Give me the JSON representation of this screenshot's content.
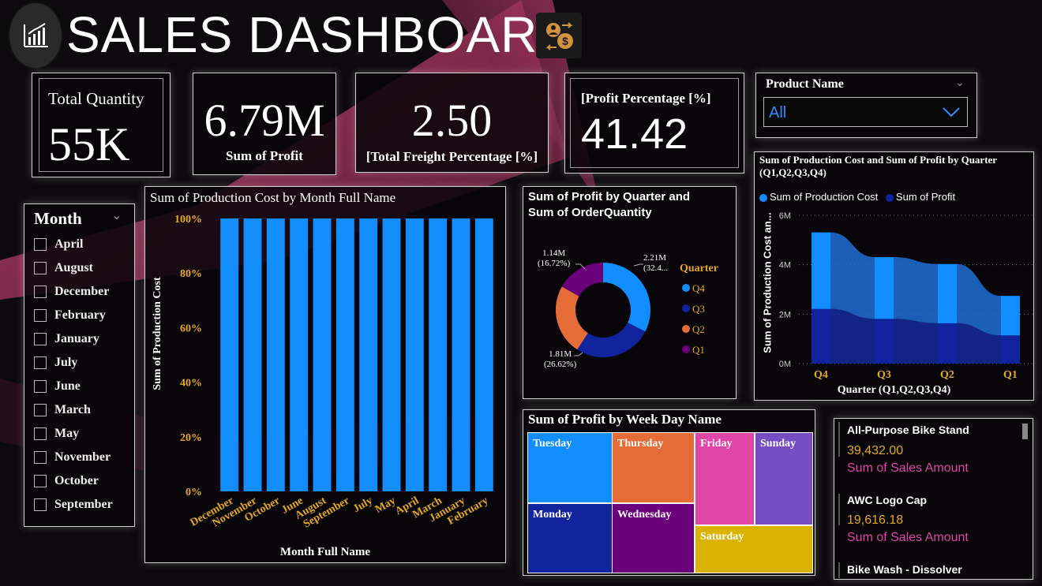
{
  "header": {
    "title": "SALES DASHBOARD"
  },
  "kpis": {
    "total_quantity_label": "Total Quantity",
    "total_quantity_value": "55K",
    "profit_value": "6.79M",
    "profit_label": "Sum of Profit",
    "freight_value": "2.50",
    "freight_label": "[Total Freight Percentage [%]",
    "profit_pct_label": "[Profit Percentage [%]",
    "profit_pct_value": "41.42"
  },
  "product_slicer": {
    "label": "Product Name",
    "value": "All"
  },
  "month_slicer": {
    "label": "Month",
    "items": [
      "April",
      "August",
      "December",
      "February",
      "January",
      "July",
      "June",
      "March",
      "May",
      "November",
      "October",
      "September"
    ]
  },
  "bar_chart": {
    "title": "Sum of Production Cost by Month Full Name",
    "xlabel": "Month Full Name",
    "ylabel": "Sum of Production Cost",
    "ticks": [
      "100%",
      "80%",
      "60%",
      "40%",
      "20%",
      "0%"
    ]
  },
  "donut_chart": {
    "title_line1": "Sum of Profit by Quarter and",
    "title_line2": "Sum of OrderQuantity",
    "legend_title": "Quarter",
    "labels": {
      "q4_value": "2.21M",
      "q4_pct": "(32.4...",
      "q3_value": "1.81M",
      "q3_pct": "(26.62%)",
      "q1_value": "1.14M",
      "q1_pct": "(16.72%)"
    }
  },
  "ribbon_chart": {
    "title": "Sum of Production Cost and Sum of Profit by Quarter (Q1,Q2,Q3,Q4)",
    "legend_a": "Sum of Production Cost",
    "legend_b": "Sum of Profit",
    "ylabel": "Sum of Production Cost an...",
    "xlabel": "Quarter (Q1,Q2,Q3,Q4)",
    "yticks": [
      "6M",
      "4M",
      "2M",
      "0M"
    ]
  },
  "treemap": {
    "title": "Sum of Profit by Week Day Name",
    "cells": {
      "tuesday": "Tuesday",
      "thursday": "Thursday",
      "friday": "Friday",
      "sunday": "Sunday",
      "monday": "Monday",
      "wednesday": "Wednesday",
      "saturday": "Saturday"
    }
  },
  "products_list": {
    "items": [
      {
        "name": "All-Purpose Bike Stand",
        "value": "39,432.00",
        "measure": "Sum of Sales Amount"
      },
      {
        "name": "AWC Logo Cap",
        "value": "19,616.18",
        "measure": "Sum of Sales Amount"
      },
      {
        "name": "Bike Wash - Dissolver",
        "value": "",
        "measure": ""
      }
    ]
  },
  "colors": {
    "bar_blue": "#118dff",
    "navy": "#12239e",
    "orange": "#e66c37",
    "purple": "#6b007b",
    "pink": "#e044a7",
    "violet": "#744ec2",
    "gold": "#d9b300",
    "axis_gold": "#e3a826"
  },
  "chart_data": [
    {
      "type": "bar",
      "title": "Sum of Production Cost by Month Full Name",
      "categories": [
        "December",
        "November",
        "October",
        "June",
        "August",
        "September",
        "July",
        "May",
        "April",
        "March",
        "January",
        "February"
      ],
      "values": [
        100,
        100,
        100,
        100,
        100,
        100,
        100,
        100,
        100,
        100,
        100,
        100
      ],
      "xlabel": "Month Full Name",
      "ylabel": "Sum of Production Cost",
      "ylim": [
        0,
        100
      ]
    },
    {
      "type": "pie",
      "title": "Sum of Profit by Quarter and Sum of OrderQuantity",
      "categories": [
        "Q4",
        "Q3",
        "Q2",
        "Q1"
      ],
      "values": [
        2.21,
        1.81,
        1.63,
        1.14
      ],
      "percent": [
        32.4,
        26.62,
        24.26,
        16.72
      ]
    },
    {
      "type": "area",
      "title": "Sum of Production Cost and Sum of Profit by Quarter (Q1,Q2,Q3,Q4)",
      "categories": [
        "Q4",
        "Q3",
        "Q2",
        "Q1"
      ],
      "series": [
        {
          "name": "Sum of Production Cost",
          "values": [
            3.1,
            2.5,
            2.4,
            1.6
          ]
        },
        {
          "name": "Sum of Profit",
          "values": [
            2.21,
            1.81,
            1.63,
            1.14
          ]
        }
      ],
      "ylim": [
        0,
        6
      ],
      "xlabel": "Quarter (Q1,Q2,Q3,Q4)",
      "ylabel": "Sum of Production Cost an..."
    },
    {
      "type": "heatmap",
      "title": "Sum of Profit by Week Day Name",
      "categories": [
        "Tuesday",
        "Thursday",
        "Friday",
        "Sunday",
        "Monday",
        "Wednesday",
        "Saturday"
      ]
    }
  ]
}
